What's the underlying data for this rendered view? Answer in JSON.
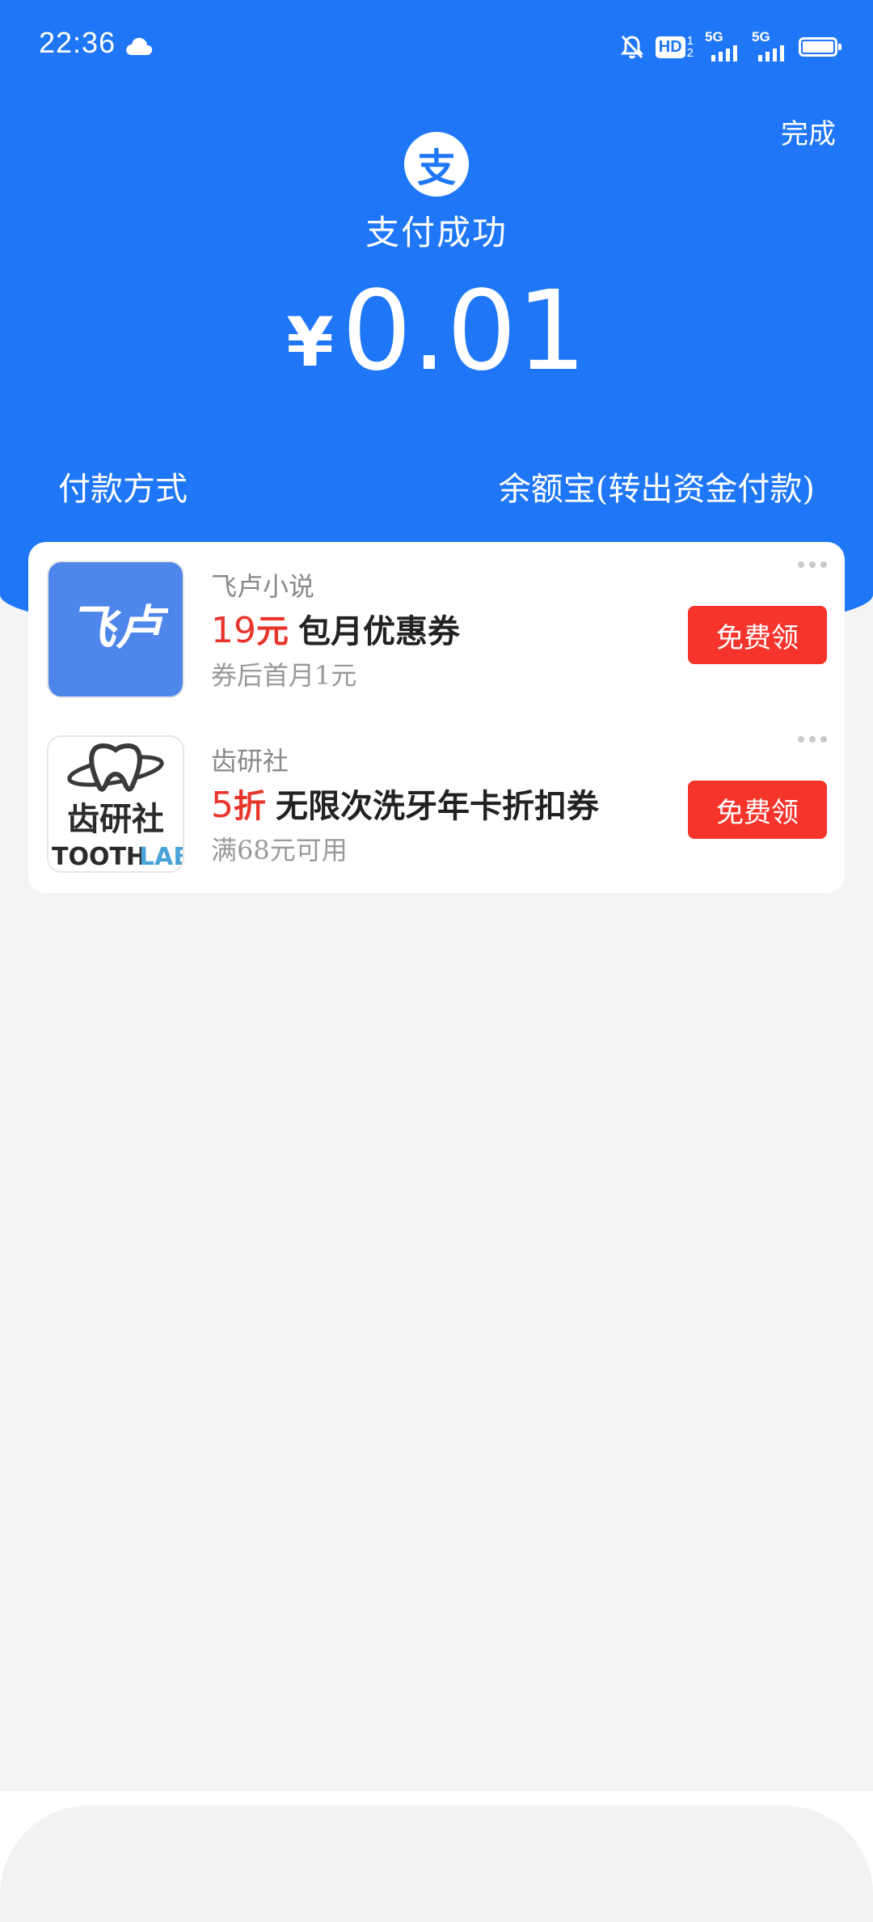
{
  "status_bar": {
    "time": "22:36",
    "hd_label": "HD",
    "hd_superscript_top": "1",
    "hd_superscript_bottom": "2",
    "sim1_label": "5G",
    "sim2_label": "5G",
    "battery_level_percent": 100
  },
  "header": {
    "done_label": "完成",
    "logo_glyph": "支",
    "title": "支付成功",
    "currency_symbol": "¥",
    "amount": "0.01",
    "pay_method_label": "付款方式",
    "pay_method_value": "余额宝(转出资金付款)"
  },
  "offers": [
    {
      "merchant": "飞卢小说",
      "highlight": "19",
      "highlight_unit": "元",
      "title": "包月优惠券",
      "subtitle": "券后首月1元",
      "button_label": "免费领",
      "logo_text": "飞卢"
    },
    {
      "merchant": "齿研社",
      "highlight": "5",
      "highlight_unit": "折",
      "title": "无限次洗牙年卡折扣券",
      "subtitle": "满68元可用",
      "button_label": "免费领",
      "logo_text_cn": "齿研社",
      "logo_text_en_a": "TOOTH",
      "logo_text_en_b": "LAB"
    }
  ],
  "colors": {
    "brand_blue": "#1f77f7",
    "claim_red": "#f5342c",
    "highlight_red": "#e8352b"
  }
}
